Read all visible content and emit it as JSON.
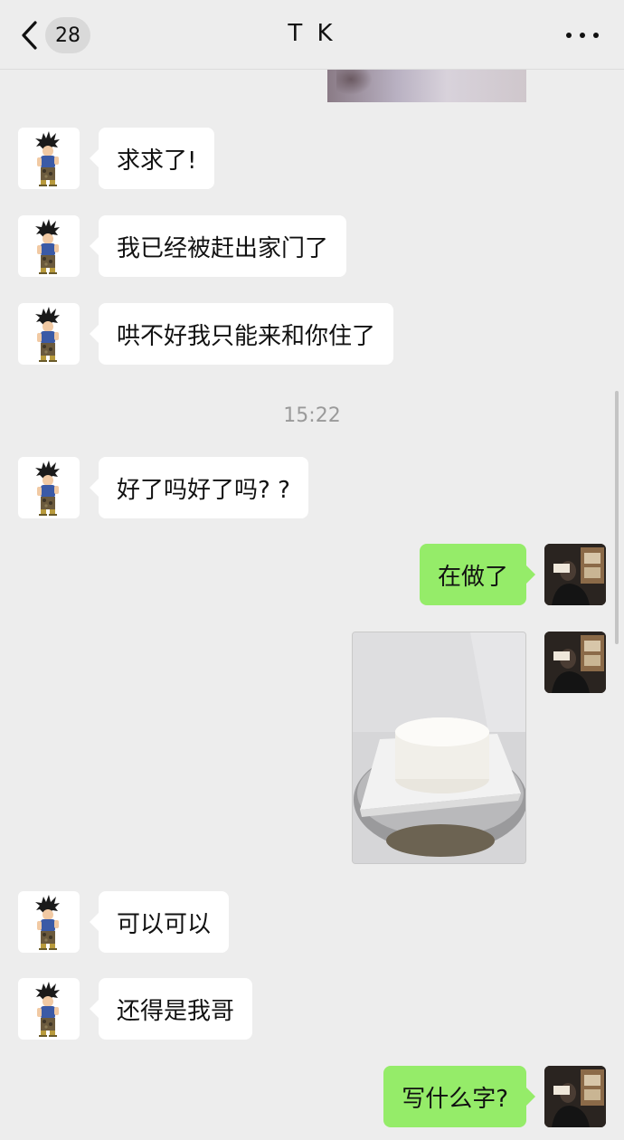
{
  "header": {
    "back_icon": "chevron-left-icon",
    "unread_count": "28",
    "title": "T K",
    "more_icon": "ellipsis-icon"
  },
  "messages": [
    {
      "side": "left",
      "text": "求求了!"
    },
    {
      "side": "left",
      "text": "我已经被赶出家门了"
    },
    {
      "side": "left",
      "text": "哄不好我只能来和你住了"
    },
    {
      "side": "left",
      "text": "好了吗好了吗? ?"
    },
    {
      "side": "right",
      "text": "在做了"
    },
    {
      "side": "right",
      "type": "image",
      "content": "cake-photo"
    },
    {
      "side": "left",
      "text": "可以可以"
    },
    {
      "side": "left",
      "text": "还得是我哥"
    },
    {
      "side": "right",
      "text": "写什么字?"
    }
  ],
  "timestamp": "15:22",
  "colors": {
    "background": "#ededed",
    "bubble_left": "#ffffff",
    "bubble_right": "#95ec69",
    "timestamp": "#9a9a9a"
  }
}
